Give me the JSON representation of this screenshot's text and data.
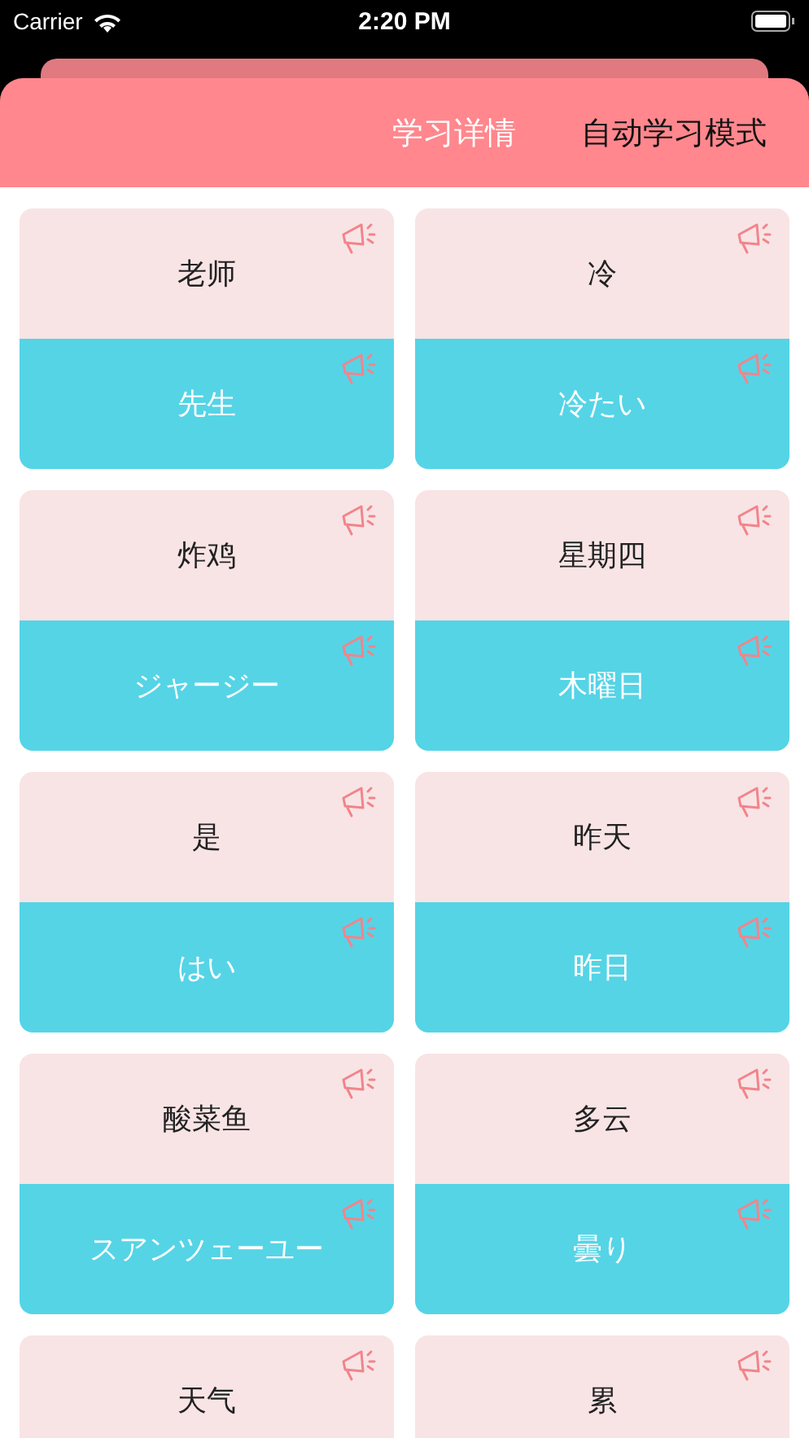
{
  "status_bar": {
    "carrier": "Carrier",
    "time": "2:20 PM"
  },
  "tabs": [
    {
      "label": "学习详情",
      "selected": false
    },
    {
      "label": "自动学习模式",
      "selected": true
    }
  ],
  "cards": [
    {
      "front": "老师",
      "back": "先生"
    },
    {
      "front": "冷",
      "back": "冷たい"
    },
    {
      "front": "炸鸡",
      "back": "ジャージー"
    },
    {
      "front": "星期四",
      "back": "木曜日"
    },
    {
      "front": "是",
      "back": "はい"
    },
    {
      "front": "昨天",
      "back": "昨日"
    },
    {
      "front": "酸菜鱼",
      "back": "スアンツェーユー"
    },
    {
      "front": "多云",
      "back": "曇り"
    },
    {
      "front": "天气"
    },
    {
      "front": "累"
    }
  ]
}
